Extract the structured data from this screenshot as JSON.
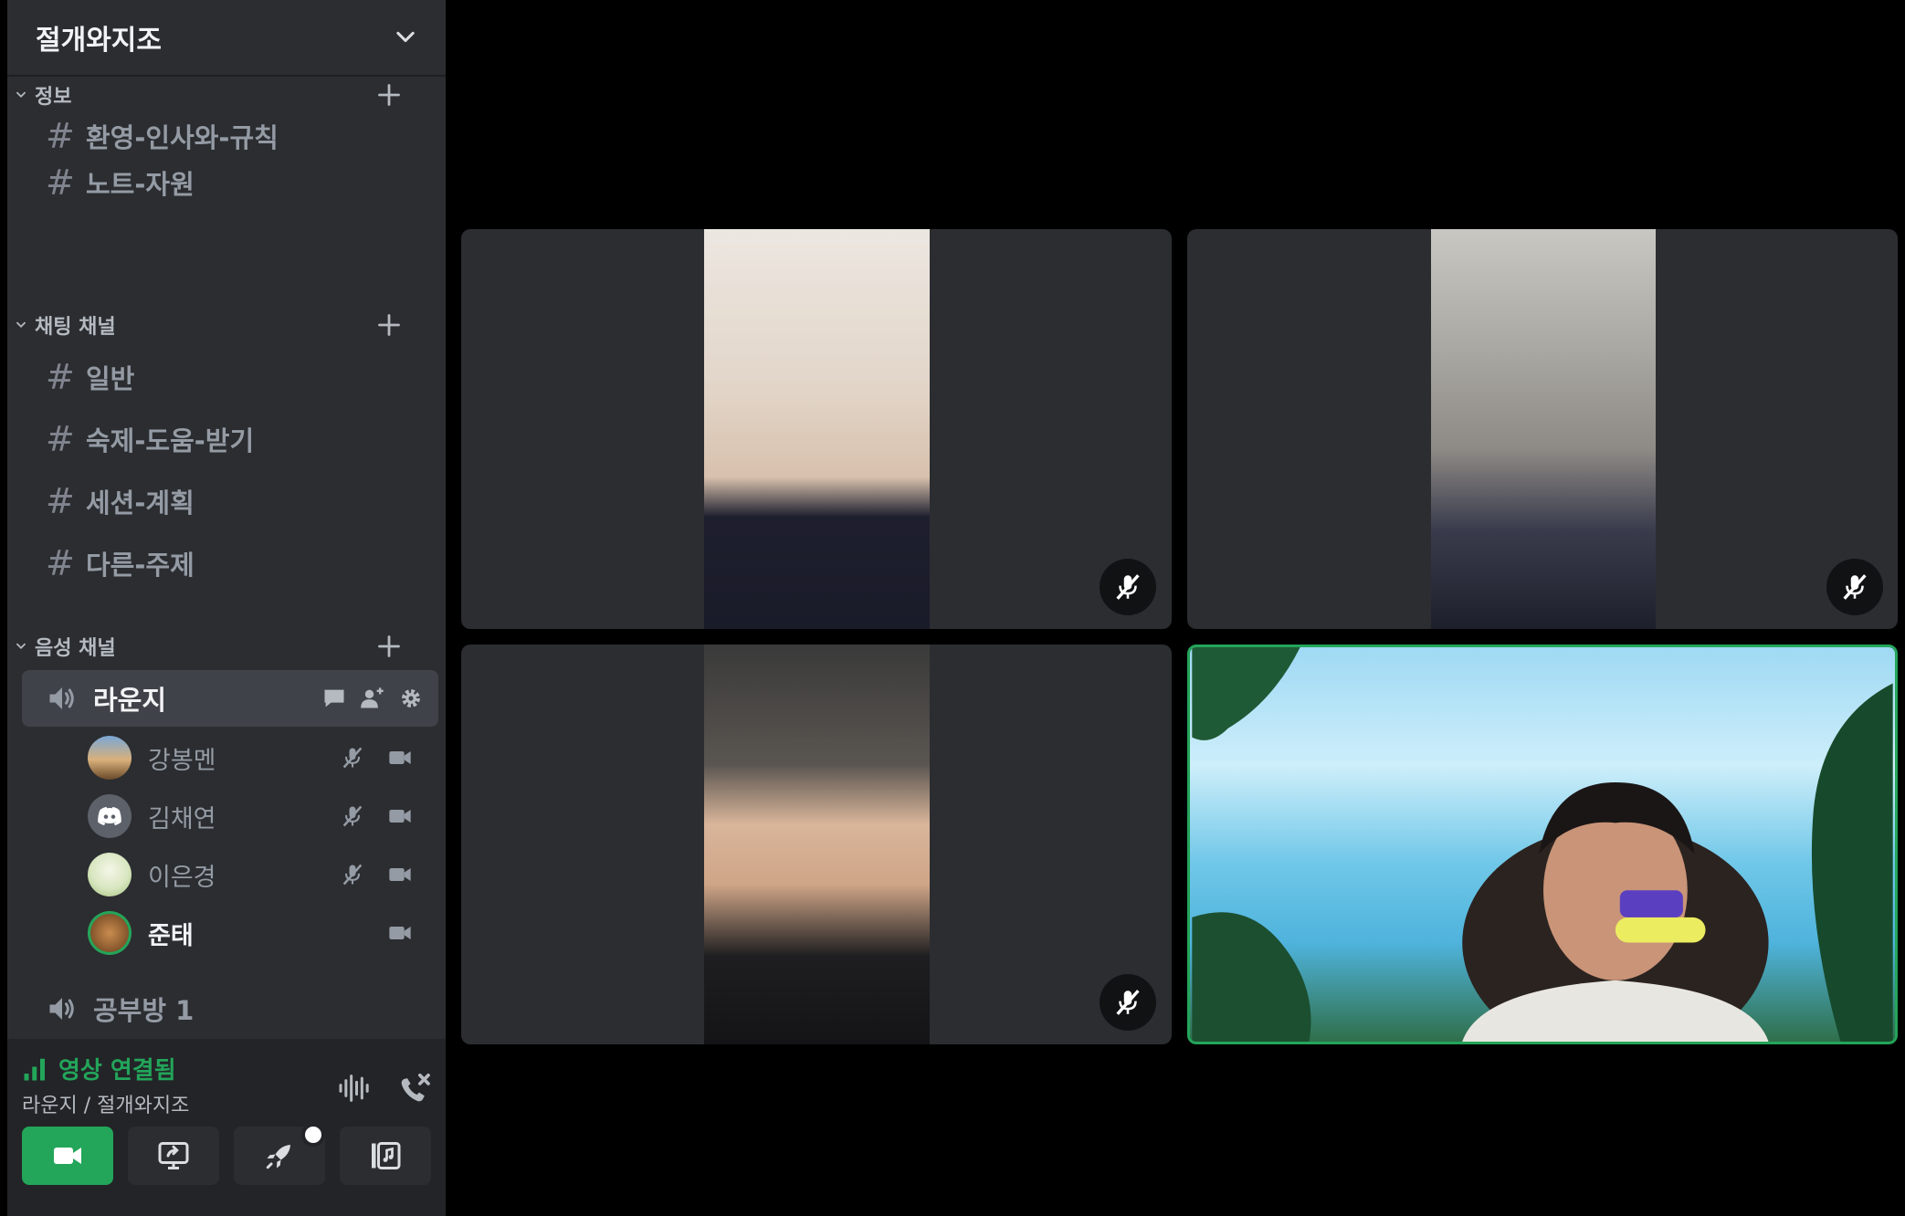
{
  "server": {
    "name": "절개와지조"
  },
  "categories": {
    "info": {
      "label": "정보",
      "channels": [
        "환영-인사와-규칙",
        "노트-자원"
      ]
    },
    "chat": {
      "label": "채팅 채널",
      "channels": [
        "일반",
        "숙제-도움-받기",
        "세션-계획",
        "다른-주제"
      ]
    },
    "voice": {
      "label": "음성 채널",
      "active_channel": "라운지",
      "members": [
        "강봉멘",
        "김채연",
        "이은경",
        "준태"
      ],
      "other_channel": "공부방 1"
    }
  },
  "voice_panel": {
    "status": "영상 연결됨",
    "location": "라운지 / 절개와지조"
  },
  "colors": {
    "sidebar_bg": "#2b2d31",
    "panel_bg": "#232428",
    "active_channel_bg": "#404249",
    "connected_green": "#23a55a",
    "tile_bg": "#2b2d31"
  },
  "icons": {
    "server_header": "chevron-down-icon",
    "category": [
      "collapse-chevron-icon",
      "plus-icon"
    ],
    "channel": "hash-icon",
    "voice_channel": "speaker-icon",
    "voice_channel_actions": [
      "chat-bubble-icon",
      "add-user-icon",
      "gear-icon"
    ],
    "member_status": [
      "mic-muted-icon",
      "camera-icon"
    ],
    "panel_actions": [
      "soundwave-icon",
      "disconnect-icon"
    ],
    "panel_buttons": [
      "camera-icon",
      "screen-share-icon",
      "rocket-activity-icon",
      "soundboard-icon"
    ],
    "tile_badge": "mic-muted-icon"
  }
}
